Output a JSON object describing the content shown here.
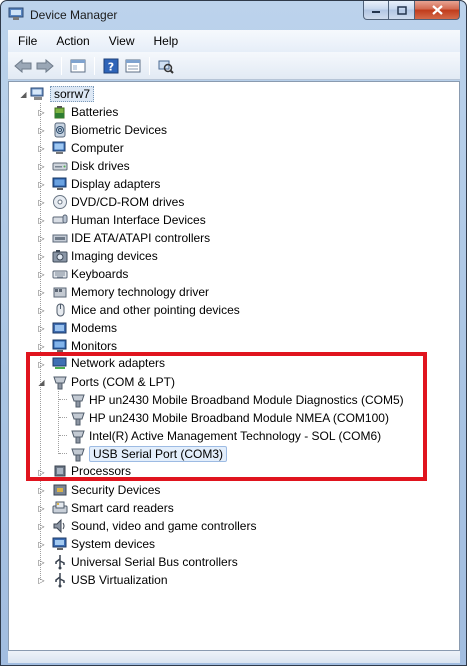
{
  "window": {
    "title": "Device Manager"
  },
  "menu": [
    "File",
    "Action",
    "View",
    "Help"
  ],
  "tree": {
    "root": "sorrw7",
    "categories": [
      "Batteries",
      "Biometric Devices",
      "Computer",
      "Disk drives",
      "Display adapters",
      "DVD/CD-ROM drives",
      "Human Interface Devices",
      "IDE ATA/ATAPI controllers",
      "Imaging devices",
      "Keyboards",
      "Memory technology driver",
      "Mice and other pointing devices",
      "Modems",
      "Monitors",
      "Network adapters",
      "Ports (COM & LPT)",
      "Processors",
      "Security Devices",
      "Smart card readers",
      "Sound, video and game controllers",
      "System devices",
      "Universal Serial Bus controllers",
      "USB Virtualization"
    ],
    "ports_children": [
      "HP un2430 Mobile Broadband Module Diagnostics (COM5)",
      "HP un2430 Mobile Broadband Module NMEA (COM100)",
      "Intel(R) Active Management Technology - SOL (COM6)",
      "USB Serial Port (COM3)"
    ]
  },
  "colors": {
    "highlight": "#e0141e"
  }
}
